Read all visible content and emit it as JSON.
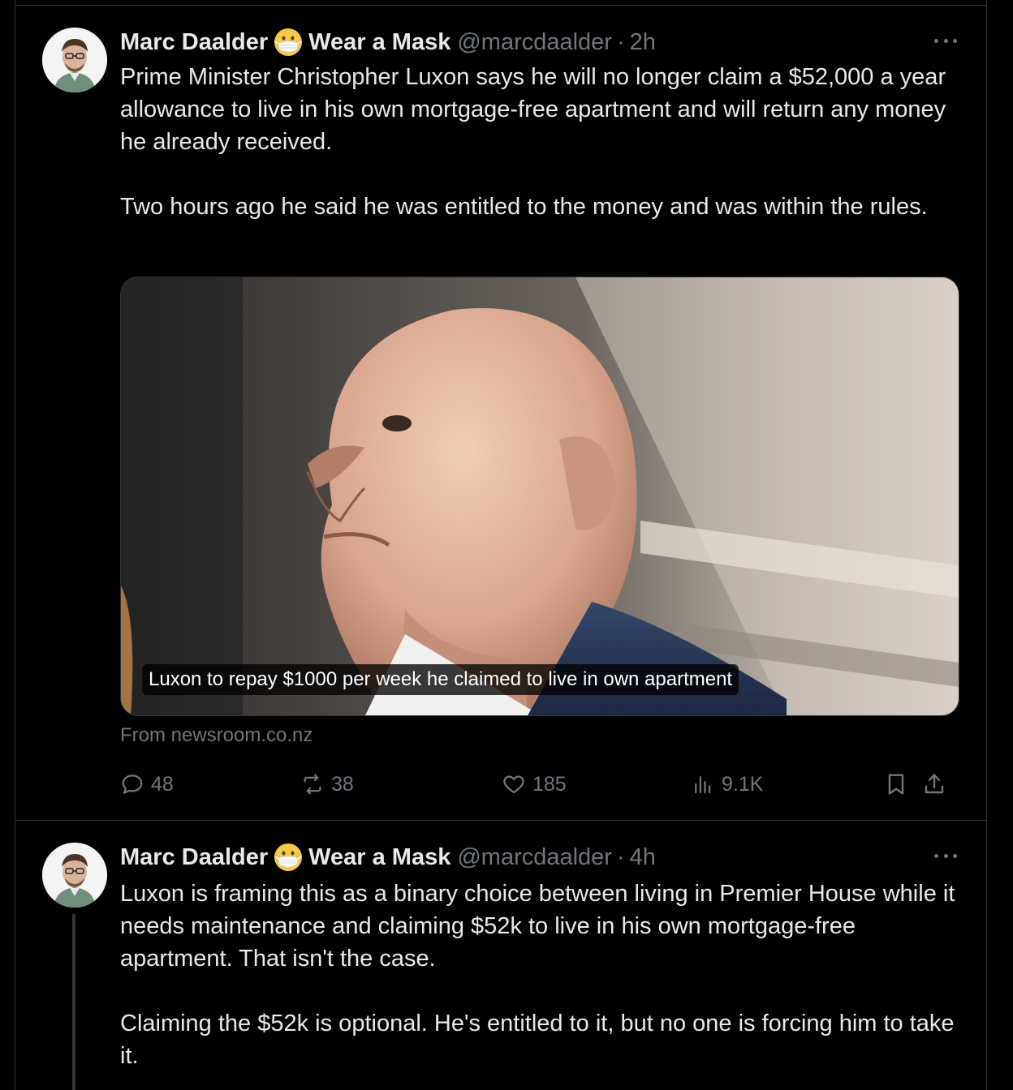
{
  "tweets": [
    {
      "author_name": "Marc Daalder",
      "display_suffix": "Wear a Mask",
      "handle": "@marcdaalder",
      "separator": "·",
      "time": "2h",
      "text": "Prime Minister Christopher Luxon says he will no longer claim a $52,000 a year allowance to live in his own mortgage-free apartment and will return any money he already received.\n\nTwo hours ago he said he was entitled to the money and was within the rules.",
      "card_caption": "Luxon to repay $1000 per week he claimed to live in own apartment",
      "card_source": "From newsroom.co.nz",
      "stats": {
        "replies": "48",
        "reposts": "38",
        "likes": "185",
        "views": "9.1K"
      }
    },
    {
      "author_name": "Marc Daalder",
      "display_suffix": "Wear a Mask",
      "handle": "@marcdaalder",
      "separator": "·",
      "time": "4h",
      "text": "Luxon is framing this as a binary choice between living in Premier House while it needs maintenance and claiming $52k to live in his own mortgage-free apartment. That isn't the case.\n\nClaiming the $52k is optional. He's entitled to it, but no one is forcing him to take it."
    }
  ],
  "icons": {
    "mask": "face-with-medical-mask-emoji",
    "reply": "reply-icon",
    "repost": "repost-icon",
    "like": "heart-icon",
    "views": "views-icon",
    "bookmark": "bookmark-icon",
    "share": "share-icon",
    "more": "more-icon"
  },
  "colors": {
    "background": "#000000",
    "text_primary": "#e7e9ea",
    "text_secondary": "#71767b",
    "border": "#2f3336"
  }
}
